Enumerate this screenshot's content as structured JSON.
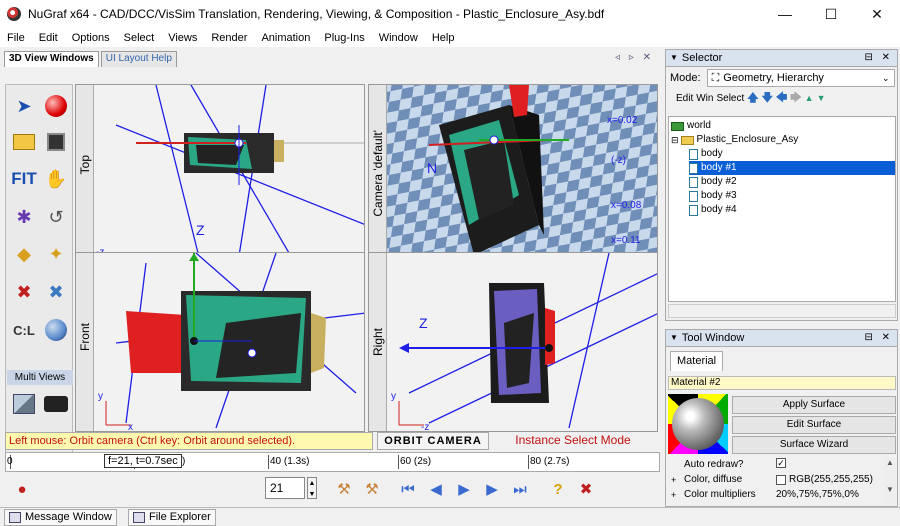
{
  "window": {
    "title": "NuGraf x64 - CAD/DCC/VisSim Translation, Rendering, Viewing, & Composition - Plastic_Enclosure_Asy.bdf",
    "min": "—",
    "max": "☐",
    "close": "✕"
  },
  "menu": [
    "File",
    "Edit",
    "Options",
    "Select",
    "Views",
    "Render",
    "Animation",
    "Plug-Ins",
    "Window",
    "Help"
  ],
  "left_tabs": [
    {
      "label": "3D View Windows",
      "active": true
    },
    {
      "label": "UI Layout Help",
      "active": false
    }
  ],
  "toolbox": {
    "fit_label": "FIT",
    "multiviews_label": "Multi Views"
  },
  "viewports": {
    "top": {
      "label": "Top",
      "axis_y": "-z",
      "axis_x": "x",
      "mid_label": "Z"
    },
    "camera": {
      "label": "Camera 'default'",
      "readouts": [
        "x=0.02",
        "(-z)",
        "x=0.08",
        "x=0.11"
      ],
      "axis_label": "N"
    },
    "front": {
      "label": "Front",
      "axis_y": "y",
      "axis_x": "x",
      "mid_label": "Z"
    },
    "right": {
      "label": "Right",
      "axis_y": "y",
      "axis_x": "-z",
      "mid_label": "Z"
    }
  },
  "status": {
    "hint": "Left mouse: Orbit camera (Ctrl key: Orbit around selected).",
    "mode": "ORBIT CAMERA",
    "select_mode": "Instance Select Mode"
  },
  "timeline": {
    "tooltip": "f=21, t=0.7sec",
    "start": "0",
    "marks": [
      "40 (1.3s)",
      "60 (2s)",
      "80 (2.7s)"
    ],
    "partial": ")"
  },
  "bottombar": {
    "frame_value": "21",
    "spin_up": "▲",
    "spin_down": "▼"
  },
  "selector": {
    "title": "Selector",
    "mode_label": "Mode:",
    "mode_value": "Geometry, Hierarchy",
    "toolbar": [
      "Edit",
      "Win",
      "Select"
    ],
    "tree": [
      {
        "label": "world",
        "level": 0,
        "icon": "folder",
        "selected": false
      },
      {
        "label": "Plastic_Enclosure_Asy",
        "level": 1,
        "icon": "folder",
        "selected": false
      },
      {
        "label": "body",
        "level": 2,
        "icon": "doc",
        "selected": false
      },
      {
        "label": "body #1",
        "level": 2,
        "icon": "doc",
        "selected": true
      },
      {
        "label": "body #2",
        "level": 2,
        "icon": "doc",
        "selected": false
      },
      {
        "label": "body #3",
        "level": 2,
        "icon": "doc",
        "selected": false
      },
      {
        "label": "body #4",
        "level": 2,
        "icon": "doc",
        "selected": false
      }
    ]
  },
  "toolwindow": {
    "title": "Tool Window",
    "tab": "Material",
    "material_name": "Material #2",
    "buttons": [
      "Apply Surface",
      "Edit Surface",
      "Surface Wizard"
    ],
    "props": [
      {
        "expand": "",
        "key": "Auto redraw?",
        "check": "✓",
        "value": ""
      },
      {
        "expand": "+",
        "key": "Color, diffuse",
        "check": "",
        "value": "RGB(255,255,255)"
      },
      {
        "expand": "+",
        "key": "Color multipliers",
        "check": null,
        "value": "20%,75%,75%,0%"
      }
    ]
  },
  "taskbar": [
    "Message Window",
    "File Explorer"
  ]
}
